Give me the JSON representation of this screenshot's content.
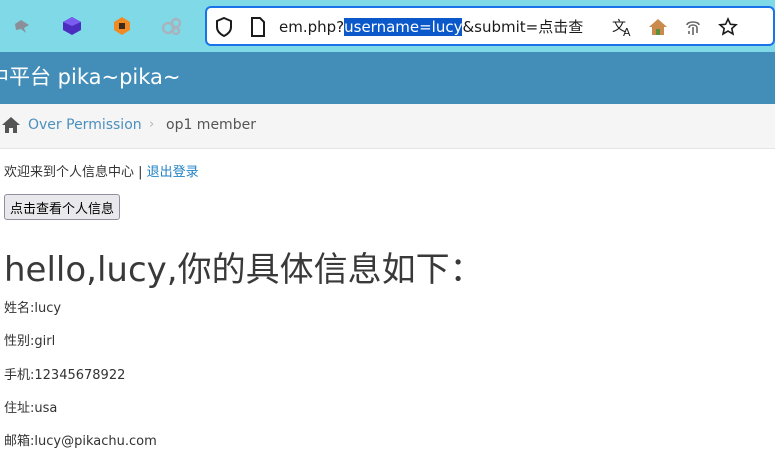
{
  "browser": {
    "extensions": [
      {
        "name": "tool-ext-icon",
        "color": "#8a8f99"
      },
      {
        "name": "cube-ext-icon",
        "color": "#4b2dbf"
      },
      {
        "name": "metamask-ext-icon",
        "color": "#f08a24"
      },
      {
        "name": "circles-ext-icon",
        "color": "#a9b3bd"
      }
    ],
    "url_prefix": "em.php?",
    "url_selected": "username=lucy",
    "url_suffix": "&submit=点击查"
  },
  "site": {
    "title": "中平台 pika~pika~"
  },
  "breadcrumb": {
    "link": "Over Permission",
    "separator": "›",
    "current": "op1 member"
  },
  "content": {
    "welcome_text": "欢迎来到个人信息中心",
    "welcome_sep": " | ",
    "logout_link": "退出登录",
    "view_button": "点击查看个人信息",
    "hello_heading": "hello,lucy,你的具体信息如下：",
    "fields": [
      {
        "label": "姓名:",
        "value": "lucy"
      },
      {
        "label": "性别:",
        "value": "girl"
      },
      {
        "label": "手机:",
        "value": "12345678922"
      },
      {
        "label": "住址:",
        "value": "usa"
      },
      {
        "label": "邮箱:",
        "value": "lucy@pikachu.com"
      }
    ]
  },
  "colors": {
    "toolbar_bg": "#7fd9e7",
    "header_bg": "#438eb9",
    "link": "#4c8fbd",
    "selection": "#0a58ca"
  }
}
